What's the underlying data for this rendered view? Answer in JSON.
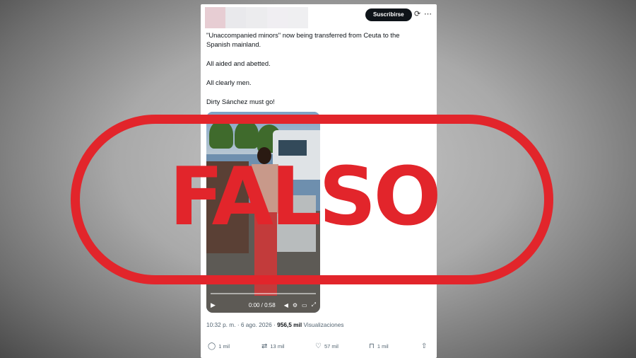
{
  "tweet": {
    "subscribe_label": "Suscribirse",
    "text_lines": [
      "\"Unaccompanied minors\" now being transferred from Ceuta to the Spanish mainland.",
      "All aided and abetted.",
      "All clearly men.",
      "Dirty Sánchez must go!"
    ],
    "video": {
      "time_display": "0:00 / 0:58"
    },
    "meta": {
      "timestamp": "10:32 p. m. · 6 ago. 2026 · ",
      "views_count": "956,5 mil",
      "views_label": " Visualizaciones"
    },
    "actions": {
      "replies": "1 mil",
      "reposts": "13 mil",
      "likes": "57 mil",
      "bookmarks": "1 mil"
    }
  },
  "stamp": {
    "label": "FALSO",
    "color": "#e2252b"
  },
  "icons": [
    "grok-icon",
    "more-icon",
    "play-icon",
    "volume-icon",
    "settings-icon",
    "pip-icon",
    "fullscreen-icon",
    "reply-icon",
    "repost-icon",
    "like-icon",
    "bookmark-icon",
    "share-icon"
  ]
}
